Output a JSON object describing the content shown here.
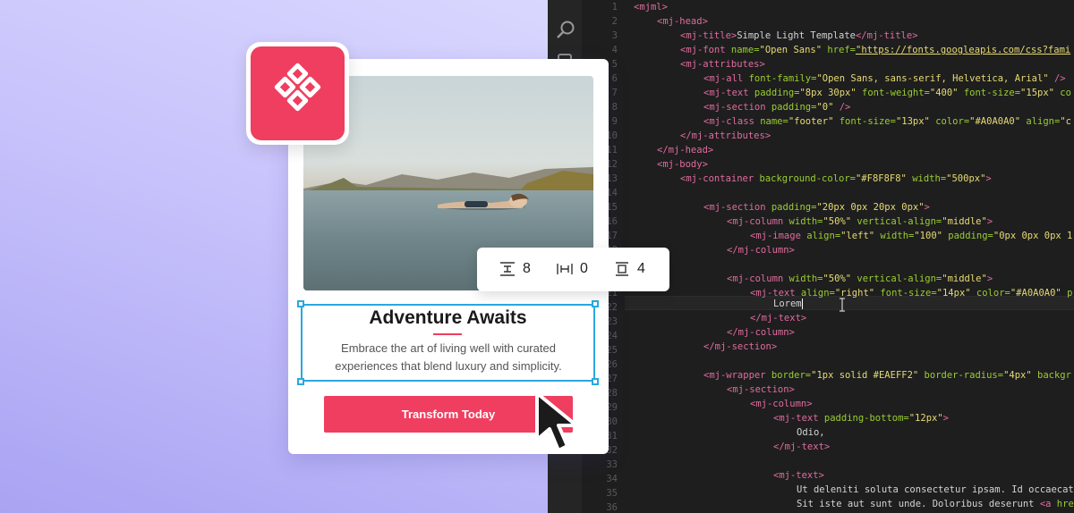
{
  "card": {
    "title": "Adventure Awaits",
    "body": "Embrace the art of living well with curated experiences that blend luxury and simplicity.",
    "cta_label": "Transform Today"
  },
  "spacing": {
    "vertical": "8",
    "horizontal": "0",
    "padding": "4"
  },
  "colors": {
    "accent": "#ef3e5f",
    "selection": "#2aa8e0",
    "editor_bg": "#1e1e1e"
  },
  "editor": {
    "line_numbers": [
      "1",
      "2",
      "3",
      "4",
      "5",
      "6",
      "7",
      "8",
      "9",
      "10",
      "11",
      "12",
      "13",
      "14",
      "15",
      "16",
      "17",
      "18",
      "19",
      "20",
      "21",
      "22",
      "23",
      "24",
      "25",
      "26",
      "27",
      "28",
      "29",
      "30",
      "31",
      "32",
      "33",
      "34",
      "35",
      "36"
    ],
    "code": {
      "l1": "<mjml>",
      "l2": "<mj-head>",
      "l3a": "<mj-title>",
      "l3b": "Simple Light Template",
      "l3c": "</mj-title>",
      "l4a": "<mj-font ",
      "l4b": "name=",
      "l4c": "\"Open Sans\"",
      "l4d": " href=",
      "l4e": "\"https://fonts.googleapis.com/css?fami",
      "l5": "<mj-attributes>",
      "l6a": "<mj-all ",
      "l6b": "font-family=",
      "l6c": "\"Open Sans, sans-serif, Helvetica, Arial\"",
      "l6d": " />",
      "l7a": "<mj-text ",
      "l7b": "padding=",
      "l7c": "\"8px 30px\"",
      "l7d": " font-weight=",
      "l7e": "\"400\"",
      "l7f": " font-size=",
      "l7g": "\"15px\"",
      "l7h": " co",
      "l8a": "<mj-section ",
      "l8b": "padding=",
      "l8c": "\"0\"",
      "l8d": " />",
      "l9a": "<mj-class ",
      "l9b": "name=",
      "l9c": "\"footer\"",
      "l9d": " font-size=",
      "l9e": "\"13px\"",
      "l9f": " color=",
      "l9g": "\"#A0A0A0\"",
      "l9h": " align=",
      "l9i": "\"c",
      "l10": "</mj-attributes>",
      "l11": "</mj-head>",
      "l12": "<mj-body>",
      "l13a": "<mj-container ",
      "l13b": "background-color=",
      "l13c": "\"#F8F8F8\"",
      "l13d": " width=",
      "l13e": "\"500px\"",
      "l13f": ">",
      "l15a": "<mj-section ",
      "l15b": "padding=",
      "l15c": "\"20px 0px 20px 0px\"",
      "l15d": ">",
      "l16a": "<mj-column ",
      "l16b": "width=",
      "l16c": "\"50%\"",
      "l16d": " vertical-align=",
      "l16e": "\"middle\"",
      "l16f": ">",
      "l17a": "<mj-image ",
      "l17b": "align=",
      "l17c": "\"left\"",
      "l17d": " width=",
      "l17e": "\"100\"",
      "l17f": " padding=",
      "l17g": "\"0px 0px 0px 1",
      "l18": "</mj-column>",
      "l20a": "<mj-column ",
      "l20b": "width=",
      "l20c": "\"50%\"",
      "l20d": " vertical-align=",
      "l20e": "\"middle\"",
      "l20f": ">",
      "l21a": "<mj-text ",
      "l21b": "align=",
      "l21c": "\"right\"",
      "l21d": " font-size=",
      "l21e": "\"14px\"",
      "l21f": " color=",
      "l21g": "\"#A0A0A0\"",
      "l21h": " p",
      "l22": "Lorem",
      "l23": "</mj-text>",
      "l24": "</mj-column>",
      "l25": "</mj-section>",
      "l27a": "<mj-wrapper ",
      "l27b": "border=",
      "l27c": "\"1px solid #EAEFF2\"",
      "l27d": " border-radius=",
      "l27e": "\"4px\"",
      "l27f": " backgr",
      "l28": "<mj-section>",
      "l29": "<mj-column>",
      "l30a": "<mj-text ",
      "l30b": "padding-bottom=",
      "l30c": "\"12px\"",
      "l30d": ">",
      "l31": "Odio,",
      "l32": "</mj-text>",
      "l34": "<mj-text>",
      "l35": "Ut deleniti soluta consectetur ipsam. Id occaecat",
      "l36a": "Sit iste aut sunt unde. Doloribus deserunt ",
      "l36b": "<a ",
      "l36c": "hre"
    }
  }
}
